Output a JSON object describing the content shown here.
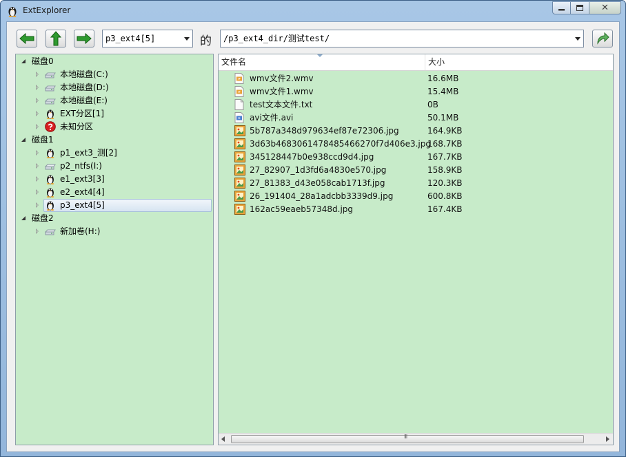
{
  "window": {
    "title": "ExtExplorer",
    "close_glyph": "✕"
  },
  "toolbar": {
    "partition_value": "p3_ext4[5]",
    "de_label": "的",
    "path_value": "/p3_ext4_dir/测试test/"
  },
  "tree": {
    "items": [
      {
        "label": "磁盘0",
        "level": 0,
        "expanded": true,
        "icon": ""
      },
      {
        "label": "本地磁盘(C:)",
        "level": 1,
        "expanded": false,
        "icon": "drive-icon"
      },
      {
        "label": "本地磁盘(D:)",
        "level": 1,
        "expanded": false,
        "icon": "drive-icon"
      },
      {
        "label": "本地磁盘(E:)",
        "level": 1,
        "expanded": false,
        "icon": "drive-icon"
      },
      {
        "label": "EXT分区[1]",
        "level": 1,
        "expanded": false,
        "icon": "linux-penguin-icon"
      },
      {
        "label": "未知分区",
        "level": 1,
        "expanded": false,
        "icon": "unknown-partition-icon"
      },
      {
        "label": "磁盘1",
        "level": 0,
        "expanded": true,
        "icon": ""
      },
      {
        "label": "p1_ext3_测[2]",
        "level": 1,
        "expanded": false,
        "icon": "linux-penguin-icon"
      },
      {
        "label": "p2_ntfs(I:)",
        "level": 1,
        "expanded": false,
        "icon": "drive-icon"
      },
      {
        "label": "e1_ext3[3]",
        "level": 1,
        "expanded": false,
        "icon": "linux-penguin-icon"
      },
      {
        "label": "e2_ext4[4]",
        "level": 1,
        "expanded": false,
        "icon": "linux-penguin-icon"
      },
      {
        "label": "p3_ext4[5]",
        "level": 1,
        "expanded": false,
        "icon": "linux-penguin-icon",
        "selected": true
      },
      {
        "label": "磁盘2",
        "level": 0,
        "expanded": true,
        "icon": ""
      },
      {
        "label": "新加卷(H:)",
        "level": 1,
        "expanded": false,
        "icon": "drive-icon"
      }
    ]
  },
  "filelist": {
    "columns": {
      "name": "文件名",
      "size": "大小"
    },
    "scroll_grip": "III",
    "files": [
      {
        "name": "wmv文件2.wmv",
        "size": "16.6MB",
        "icon": "video-file-icon"
      },
      {
        "name": "wmv文件1.wmv",
        "size": "15.4MB",
        "icon": "video-file-icon"
      },
      {
        "name": "test文本文件.txt",
        "size": "0B",
        "icon": "text-file-icon"
      },
      {
        "name": "avi文件.avi",
        "size": "50.1MB",
        "icon": "avi-file-icon"
      },
      {
        "name": "5b787a348d979634ef87e72306.jpg",
        "size": "164.9KB",
        "icon": "image-file-icon"
      },
      {
        "name": "3d63b4683061478485466270f7d406e3.jpg",
        "size": "168.7KB",
        "icon": "image-file-icon"
      },
      {
        "name": "345128447b0e938ccd9d4.jpg",
        "size": "167.7KB",
        "icon": "image-file-icon"
      },
      {
        "name": "27_82907_1d3fd6a4830e570.jpg",
        "size": "158.9KB",
        "icon": "image-file-icon"
      },
      {
        "name": "27_81383_d43e058cab1713f.jpg",
        "size": "120.3KB",
        "icon": "image-file-icon"
      },
      {
        "name": "26_191404_28a1adcbb3339d9.jpg",
        "size": "600.8KB",
        "icon": "image-file-icon"
      },
      {
        "name": "162ac59eaeb57348d.jpg",
        "size": "167.4KB",
        "icon": "image-file-icon"
      }
    ]
  },
  "colors": {
    "pane_bg": "#c7ebc9",
    "arrow_green": "#2f9a2f",
    "titlebar": "#a8c7e6"
  }
}
